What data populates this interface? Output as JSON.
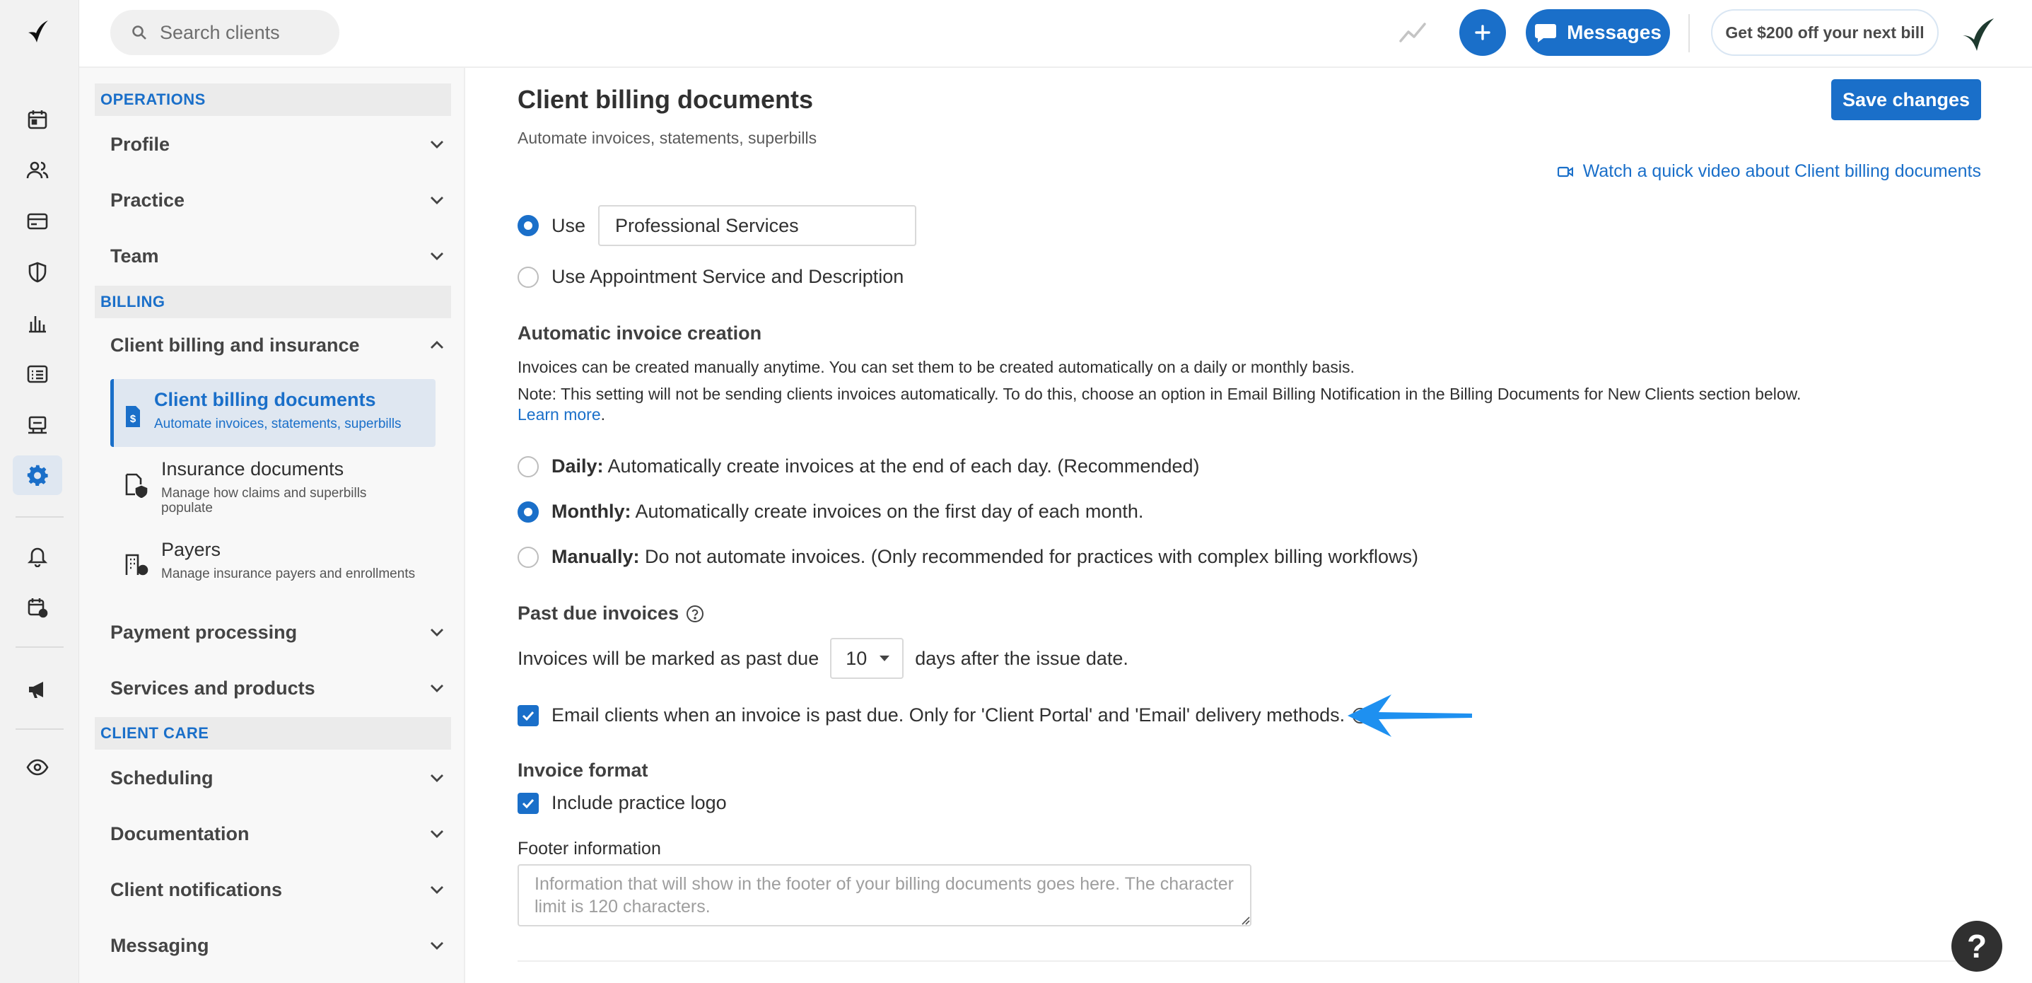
{
  "search": {
    "placeholder": "Search clients"
  },
  "header": {
    "messages_label": "Messages",
    "promo_label": "Get $200 off your next bill"
  },
  "nav": {
    "sections": {
      "operations": "OPERATIONS",
      "billing": "BILLING",
      "client_care": "CLIENT CARE"
    },
    "groups": {
      "profile": "Profile",
      "practice": "Practice",
      "team": "Team",
      "client_billing_insurance": "Client billing and insurance",
      "payment_processing": "Payment processing",
      "services_products": "Services and products",
      "scheduling": "Scheduling",
      "documentation": "Documentation",
      "client_notifications": "Client notifications",
      "messaging": "Messaging"
    },
    "subitems": [
      {
        "title": "Client billing documents",
        "desc": "Automate invoices, statements, superbills"
      },
      {
        "title": "Insurance documents",
        "desc": "Manage how claims and superbills populate"
      },
      {
        "title": "Payers",
        "desc": "Manage insurance payers and enrollments"
      }
    ]
  },
  "page": {
    "title": "Client billing documents",
    "subtitle": "Automate invoices, statements, superbills",
    "save_label": "Save changes",
    "video_link": "Watch a quick video about Client billing documents",
    "use_label": "Use",
    "use_value": "Professional Services",
    "use_appointment_label": "Use Appointment Service and Description",
    "auto_invoice": {
      "heading": "Automatic invoice creation",
      "line1": "Invoices can be created manually anytime. You can set them to be created automatically on a daily or monthly basis.",
      "line2": "Note: This setting will not be sending clients invoices automatically. To do this, choose an option in Email Billing Notification in the Billing Documents for New Clients section below.",
      "learn_more": "Learn more",
      "options": [
        {
          "label": "Daily:",
          "text": "Automatically create invoices at the end of each day. (Recommended)",
          "selected": false
        },
        {
          "label": "Monthly:",
          "text": "Automatically create invoices on the first day of each month.",
          "selected": true
        },
        {
          "label": "Manually:",
          "text": "Do not automate invoices. (Only recommended for practices with complex billing workflows)",
          "selected": false
        }
      ]
    },
    "past_due": {
      "heading": "Past due invoices",
      "prefix": "Invoices will be marked as past due",
      "days_value": "10",
      "suffix": "days after the issue date.",
      "email_label": "Email clients when an invoice is past due. Only for 'Client Portal' and 'Email' delivery methods.",
      "email_checked": true
    },
    "invoice_format": {
      "heading": "Invoice format",
      "include_logo_label": "Include practice logo",
      "include_logo_checked": true,
      "footer_label": "Footer information",
      "footer_placeholder": "Information that will show in the footer of your billing documents goes here. The character limit is 120 characters."
    }
  },
  "help_label": "?",
  "colors": {
    "accent": "#1a6fc9",
    "arrow": "#1e90f0",
    "brand_dark": "#1e3a2f"
  }
}
